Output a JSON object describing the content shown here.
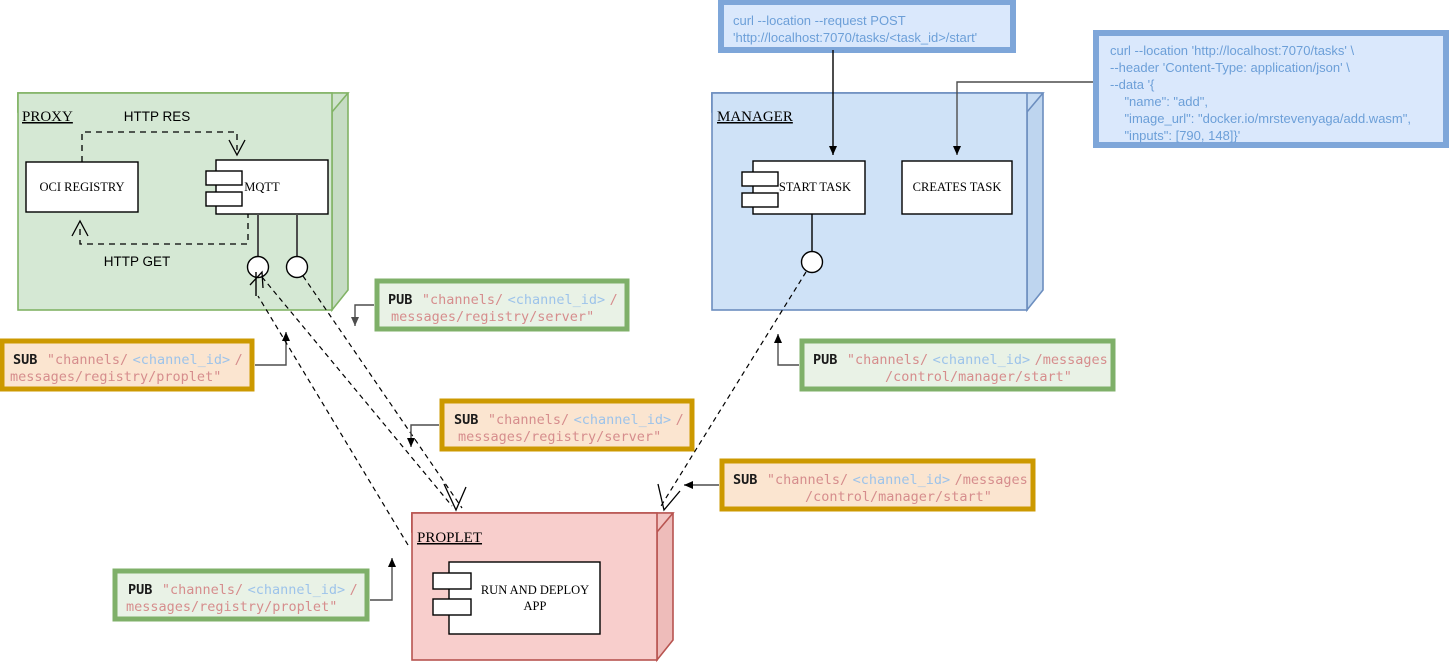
{
  "diagram": {
    "title": "Proxy / Manager / Proplet MQTT architecture",
    "colors": {
      "proxy_fill": "#d5e8d4",
      "proxy_stroke": "#82b366",
      "manager_fill": "#cfe2f7",
      "manager_stroke": "#6c8ebf",
      "proplet_fill": "#f8cecc",
      "proplet_stroke": "#b85450",
      "curl_fill": "#dae8fc",
      "curl_stroke": "#7ea6d9",
      "curl_text": "#6c9fd8",
      "pub_fill": "#e9f2e6",
      "pub_stroke": "#7fb069",
      "sub_fill": "#fbe5d0",
      "sub_stroke": "#cc9900",
      "topic_string": "#d68d8d",
      "topic_var": "#9dc3ea"
    }
  },
  "containers": {
    "proxy": {
      "label": "PROXY",
      "components": [
        {
          "name": "OCI REGISTRY"
        },
        {
          "name": "MQTT"
        }
      ],
      "edges": [
        {
          "label": "HTTP RES"
        },
        {
          "label": "HTTP GET"
        }
      ]
    },
    "manager": {
      "label": "MANAGER",
      "components": [
        {
          "name": "START TASK"
        },
        {
          "name": "CREATES TASK"
        }
      ]
    },
    "proplet": {
      "label": "PROPLET",
      "components": [
        {
          "name_line1": "RUN AND DEPLOY",
          "name_line2": "APP"
        }
      ]
    }
  },
  "curl_boxes": [
    {
      "id": "curl-start-task",
      "lines": [
        "curl --location --request POST",
        "'http://localhost:7070/tasks/<task_id>/start'"
      ]
    },
    {
      "id": "curl-create-task",
      "lines": [
        "curl --location 'http://localhost:7070/tasks' \\",
        "--header 'Content-Type: application/json' \\",
        "--data '{",
        "    \"name\": \"add\",",
        "    \"image_url\": \"docker.io/mrstevenyaga/add.wasm\",",
        "    \"inputs\": [790, 148]}'"
      ]
    }
  ],
  "topic_boxes": [
    {
      "id": "pub-registry-server",
      "kind": "PUB",
      "style": "pub",
      "line1_pre": "\"channels/",
      "line1_var": "<channel_id>",
      "line1_post": "/",
      "line2": "messages/registry/server\""
    },
    {
      "id": "sub-registry-proplet",
      "kind": "SUB",
      "style": "sub",
      "line1_pre": "\"channels/",
      "line1_var": "<channel_id>",
      "line1_post": "/",
      "line2": "messages/registry/proplet\""
    },
    {
      "id": "sub-registry-server",
      "kind": "SUB",
      "style": "sub",
      "line1_pre": "\"channels/",
      "line1_var": "<channel_id>",
      "line1_post": "/",
      "line2": "messages/registry/server\""
    },
    {
      "id": "pub-control-manager-start",
      "kind": "PUB",
      "style": "pub",
      "line1_pre": "\"channels/",
      "line1_var": "<channel_id>",
      "line1_post": "/messages",
      "line2": "/control/manager/start\""
    },
    {
      "id": "sub-control-manager-start",
      "kind": "SUB",
      "style": "sub",
      "line1_pre": "\"channels/",
      "line1_var": "<channel_id>",
      "line1_post": "/messages",
      "line2": "/control/manager/start\""
    },
    {
      "id": "pub-registry-proplet",
      "kind": "PUB",
      "style": "pub",
      "line1_pre": "\"channels/",
      "line1_var": "<channel_id>",
      "line1_post": "/",
      "line2": "messages/registry/proplet\""
    }
  ]
}
